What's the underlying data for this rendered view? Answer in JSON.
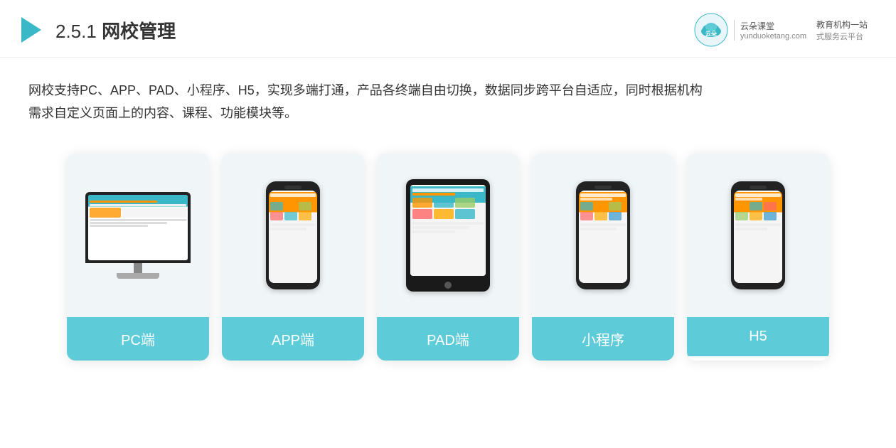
{
  "header": {
    "title_prefix": "2.5.1 ",
    "title_main": "网校管理",
    "brand": {
      "name": "云朵课堂",
      "url_text": "yunduoketang.com",
      "tagline_1": "教育机构一站",
      "tagline_2": "式服务云平台"
    }
  },
  "description": {
    "text_line1": "网校支持PC、APP、PAD、小程序、H5，实现多端打通，产品各终端自由切换，数据同步跨平台自适应，同时根据机构",
    "text_line2": "需求自定义页面上的内容、课程、功能模块等。"
  },
  "cards": [
    {
      "id": "pc",
      "label": "PC端"
    },
    {
      "id": "app",
      "label": "APP端"
    },
    {
      "id": "pad",
      "label": "PAD端"
    },
    {
      "id": "miniprogram",
      "label": "小程序"
    },
    {
      "id": "h5",
      "label": "H5"
    }
  ]
}
